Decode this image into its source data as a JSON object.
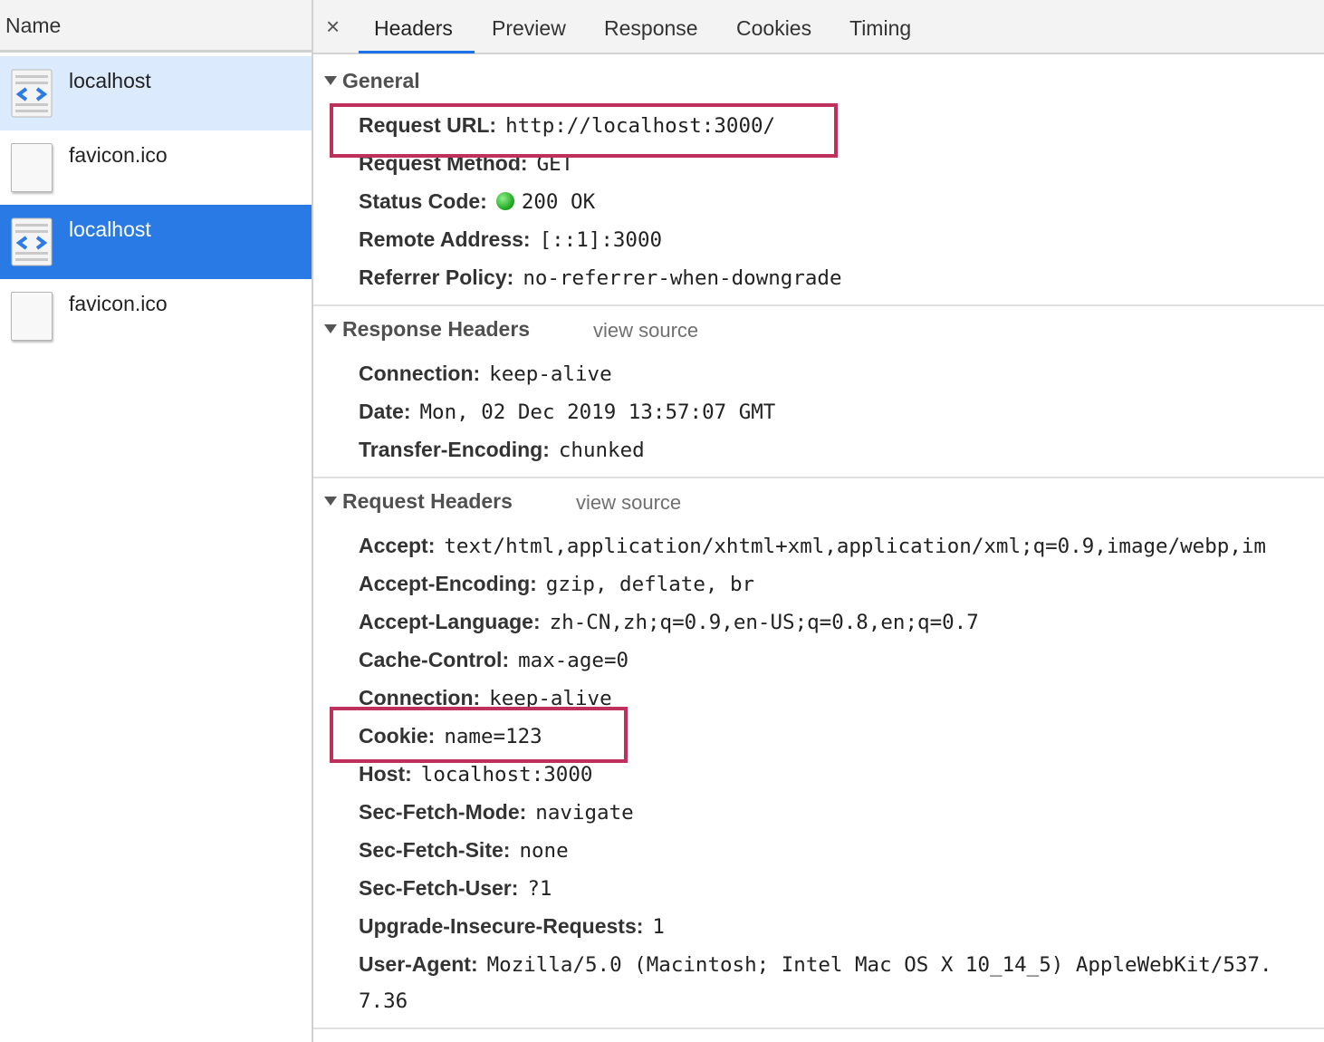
{
  "left_panel": {
    "column_header": "Name",
    "requests": [
      {
        "name": "localhost",
        "type": "document-icon",
        "state": "selected-inactive"
      },
      {
        "name": "favicon.ico",
        "type": "blank-icon",
        "state": "normal"
      },
      {
        "name": "localhost",
        "type": "document-icon",
        "state": "selected"
      },
      {
        "name": "favicon.ico",
        "type": "blank-icon",
        "state": "normal"
      }
    ]
  },
  "tabs": {
    "close": "×",
    "items": [
      "Headers",
      "Preview",
      "Response",
      "Cookies",
      "Timing"
    ],
    "active": "Headers"
  },
  "general": {
    "title": "General",
    "rows": [
      {
        "key": "Request URL:",
        "value": "http://localhost:3000/"
      },
      {
        "key": "Request Method:",
        "value": "GET"
      },
      {
        "key": "Status Code:",
        "value": "200 OK"
      },
      {
        "key": "Remote Address:",
        "value": "[::1]:3000"
      },
      {
        "key": "Referrer Policy:",
        "value": "no-referrer-when-downgrade"
      }
    ]
  },
  "response_headers": {
    "title": "Response Headers",
    "view_source": "view source",
    "rows": [
      {
        "key": "Connection:",
        "value": "keep-alive"
      },
      {
        "key": "Date:",
        "value": "Mon, 02 Dec 2019 13:57:07 GMT"
      },
      {
        "key": "Transfer-Encoding:",
        "value": "chunked"
      }
    ]
  },
  "request_headers": {
    "title": "Request Headers",
    "view_source": "view source",
    "rows": [
      {
        "key": "Accept:",
        "value": "text/html,application/xhtml+xml,application/xml;q=0.9,image/webp,im"
      },
      {
        "key": "Accept-Encoding:",
        "value": "gzip, deflate, br"
      },
      {
        "key": "Accept-Language:",
        "value": "zh-CN,zh;q=0.9,en-US;q=0.8,en;q=0.7"
      },
      {
        "key": "Cache-Control:",
        "value": "max-age=0"
      },
      {
        "key": "Connection:",
        "value": "keep-alive"
      },
      {
        "key": "Cookie:",
        "value": "name=123"
      },
      {
        "key": "Host:",
        "value": "localhost:3000"
      },
      {
        "key": "Sec-Fetch-Mode:",
        "value": "navigate"
      },
      {
        "key": "Sec-Fetch-Site:",
        "value": "none"
      },
      {
        "key": "Sec-Fetch-User:",
        "value": "?1"
      },
      {
        "key": "Upgrade-Insecure-Requests:",
        "value": "1"
      },
      {
        "key": "User-Agent:",
        "value": "Mozilla/5.0 (Macintosh; Intel Mac OS X 10_14_5) AppleWebKit/537."
      }
    ],
    "user_agent_wrap": "7.36"
  },
  "colors": {
    "selected_blue": "#2a7ae6",
    "selected_light": "#dbeafd",
    "highlight_box": "#c0305d",
    "tab_underline": "#1a73e8",
    "status_green": "#18a21a"
  }
}
